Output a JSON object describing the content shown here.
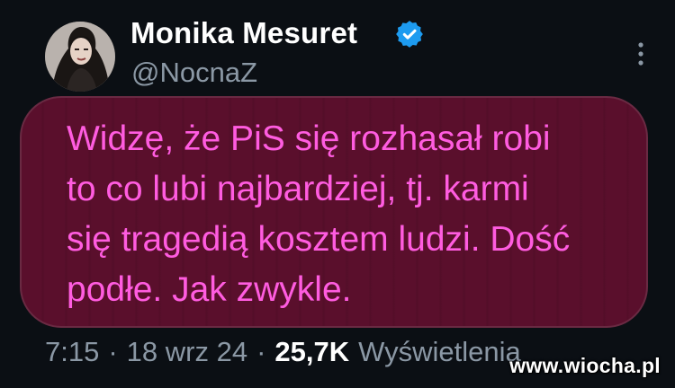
{
  "tweet": {
    "author": {
      "name": "Monika Mesuret",
      "handle": "@NocnaZ",
      "verified": true,
      "avatar_icon": "profile-photo"
    },
    "text": "Widzę, że PiS się rozhasał robi\nto co lubi najbardziej, tj. karmi\nsię tragedią kosztem ludzi. Dość\npodłe. Jak zwykle.",
    "time": "7:15",
    "separator": "·",
    "date": "18 wrz 24",
    "views_count": "25,7K",
    "views_label": "Wyświetlenia"
  },
  "watermark": "www.wiocha.pl",
  "colors": {
    "background": "#0b0f14",
    "bubble": "#5a0f2c",
    "bubble_text": "#ff5ce0",
    "verified": "#1d9bf0",
    "secondary_text": "#8b98a5"
  },
  "icons": {
    "verified": "verified-badge-icon",
    "more": "more-vertical-icon"
  }
}
